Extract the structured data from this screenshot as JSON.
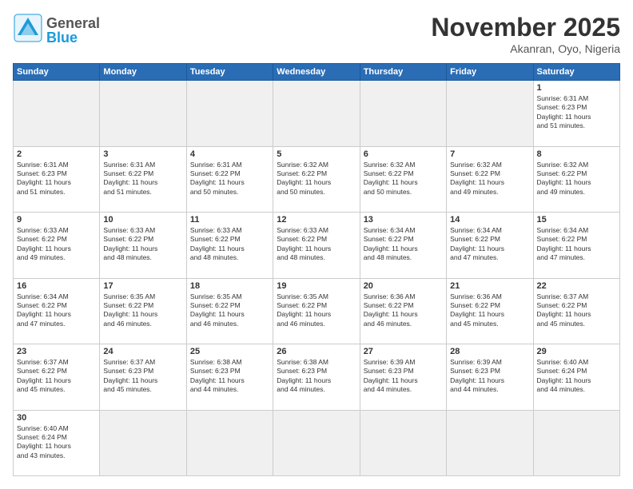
{
  "header": {
    "month_title": "November 2025",
    "location": "Akanran, Oyo, Nigeria",
    "logo_general": "General",
    "logo_blue": "Blue"
  },
  "days_of_week": [
    "Sunday",
    "Monday",
    "Tuesday",
    "Wednesday",
    "Thursday",
    "Friday",
    "Saturday"
  ],
  "weeks": [
    [
      {
        "day": "",
        "content": ""
      },
      {
        "day": "",
        "content": ""
      },
      {
        "day": "",
        "content": ""
      },
      {
        "day": "",
        "content": ""
      },
      {
        "day": "",
        "content": ""
      },
      {
        "day": "",
        "content": ""
      },
      {
        "day": "1",
        "content": "Sunrise: 6:31 AM\nSunset: 6:23 PM\nDaylight: 11 hours\nand 51 minutes."
      }
    ],
    [
      {
        "day": "2",
        "content": "Sunrise: 6:31 AM\nSunset: 6:23 PM\nDaylight: 11 hours\nand 51 minutes."
      },
      {
        "day": "3",
        "content": "Sunrise: 6:31 AM\nSunset: 6:22 PM\nDaylight: 11 hours\nand 51 minutes."
      },
      {
        "day": "4",
        "content": "Sunrise: 6:31 AM\nSunset: 6:22 PM\nDaylight: 11 hours\nand 50 minutes."
      },
      {
        "day": "5",
        "content": "Sunrise: 6:32 AM\nSunset: 6:22 PM\nDaylight: 11 hours\nand 50 minutes."
      },
      {
        "day": "6",
        "content": "Sunrise: 6:32 AM\nSunset: 6:22 PM\nDaylight: 11 hours\nand 50 minutes."
      },
      {
        "day": "7",
        "content": "Sunrise: 6:32 AM\nSunset: 6:22 PM\nDaylight: 11 hours\nand 49 minutes."
      },
      {
        "day": "8",
        "content": "Sunrise: 6:32 AM\nSunset: 6:22 PM\nDaylight: 11 hours\nand 49 minutes."
      }
    ],
    [
      {
        "day": "9",
        "content": "Sunrise: 6:33 AM\nSunset: 6:22 PM\nDaylight: 11 hours\nand 49 minutes."
      },
      {
        "day": "10",
        "content": "Sunrise: 6:33 AM\nSunset: 6:22 PM\nDaylight: 11 hours\nand 48 minutes."
      },
      {
        "day": "11",
        "content": "Sunrise: 6:33 AM\nSunset: 6:22 PM\nDaylight: 11 hours\nand 48 minutes."
      },
      {
        "day": "12",
        "content": "Sunrise: 6:33 AM\nSunset: 6:22 PM\nDaylight: 11 hours\nand 48 minutes."
      },
      {
        "day": "13",
        "content": "Sunrise: 6:34 AM\nSunset: 6:22 PM\nDaylight: 11 hours\nand 48 minutes."
      },
      {
        "day": "14",
        "content": "Sunrise: 6:34 AM\nSunset: 6:22 PM\nDaylight: 11 hours\nand 47 minutes."
      },
      {
        "day": "15",
        "content": "Sunrise: 6:34 AM\nSunset: 6:22 PM\nDaylight: 11 hours\nand 47 minutes."
      }
    ],
    [
      {
        "day": "16",
        "content": "Sunrise: 6:34 AM\nSunset: 6:22 PM\nDaylight: 11 hours\nand 47 minutes."
      },
      {
        "day": "17",
        "content": "Sunrise: 6:35 AM\nSunset: 6:22 PM\nDaylight: 11 hours\nand 46 minutes."
      },
      {
        "day": "18",
        "content": "Sunrise: 6:35 AM\nSunset: 6:22 PM\nDaylight: 11 hours\nand 46 minutes."
      },
      {
        "day": "19",
        "content": "Sunrise: 6:35 AM\nSunset: 6:22 PM\nDaylight: 11 hours\nand 46 minutes."
      },
      {
        "day": "20",
        "content": "Sunrise: 6:36 AM\nSunset: 6:22 PM\nDaylight: 11 hours\nand 46 minutes."
      },
      {
        "day": "21",
        "content": "Sunrise: 6:36 AM\nSunset: 6:22 PM\nDaylight: 11 hours\nand 45 minutes."
      },
      {
        "day": "22",
        "content": "Sunrise: 6:37 AM\nSunset: 6:22 PM\nDaylight: 11 hours\nand 45 minutes."
      }
    ],
    [
      {
        "day": "23",
        "content": "Sunrise: 6:37 AM\nSunset: 6:22 PM\nDaylight: 11 hours\nand 45 minutes."
      },
      {
        "day": "24",
        "content": "Sunrise: 6:37 AM\nSunset: 6:23 PM\nDaylight: 11 hours\nand 45 minutes."
      },
      {
        "day": "25",
        "content": "Sunrise: 6:38 AM\nSunset: 6:23 PM\nDaylight: 11 hours\nand 44 minutes."
      },
      {
        "day": "26",
        "content": "Sunrise: 6:38 AM\nSunset: 6:23 PM\nDaylight: 11 hours\nand 44 minutes."
      },
      {
        "day": "27",
        "content": "Sunrise: 6:39 AM\nSunset: 6:23 PM\nDaylight: 11 hours\nand 44 minutes."
      },
      {
        "day": "28",
        "content": "Sunrise: 6:39 AM\nSunset: 6:23 PM\nDaylight: 11 hours\nand 44 minutes."
      },
      {
        "day": "29",
        "content": "Sunrise: 6:40 AM\nSunset: 6:24 PM\nDaylight: 11 hours\nand 44 minutes."
      }
    ],
    [
      {
        "day": "30",
        "content": "Sunrise: 6:40 AM\nSunset: 6:24 PM\nDaylight: 11 hours\nand 43 minutes."
      },
      {
        "day": "",
        "content": ""
      },
      {
        "day": "",
        "content": ""
      },
      {
        "day": "",
        "content": ""
      },
      {
        "day": "",
        "content": ""
      },
      {
        "day": "",
        "content": ""
      },
      {
        "day": "",
        "content": ""
      }
    ]
  ]
}
